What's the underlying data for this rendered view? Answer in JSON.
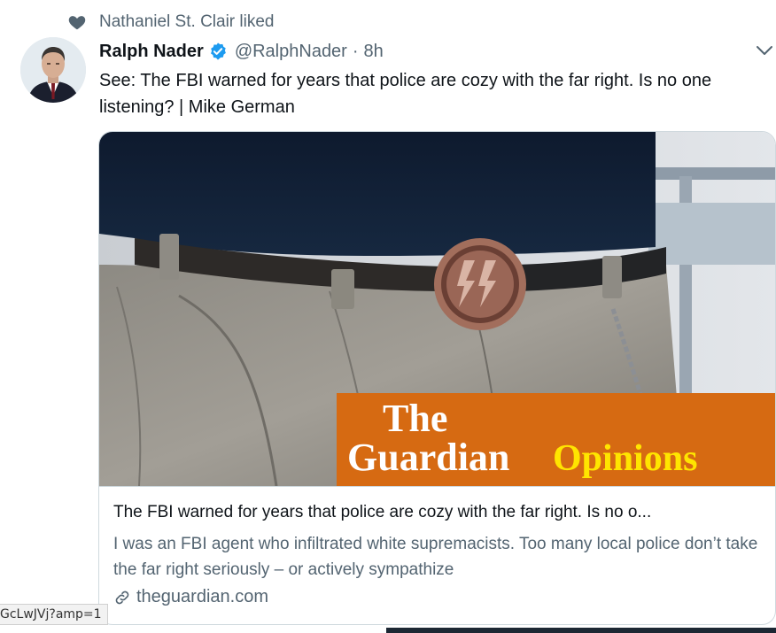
{
  "social_context": {
    "icon": "heart-icon",
    "text": "Nathaniel St. Clair liked"
  },
  "author": {
    "name": "Ralph Nader",
    "verified": true,
    "handle": "@RalphNader",
    "separator": "·",
    "time": "8h"
  },
  "tweet": {
    "text": "See: The FBI warned for years that police are cozy with the far right. Is no one listening? | Mike German"
  },
  "card": {
    "image_logo_the": "The",
    "image_logo_guardian": "Guardian",
    "image_logo_opinions": "Opinions",
    "title": "The FBI warned for years that police are cozy with the far right. Is no o...",
    "description": "I was an FBI agent who infiltrated white supremacists. Too many local police don’t take the far right seriously – or actively sympathize",
    "domain": "theguardian.com",
    "domain_icon": "link-icon"
  },
  "status_bar": {
    "url": "GcLwJVj?amp=1"
  },
  "colors": {
    "accent_verified": "#1d9bf0",
    "secondary_text": "#536471",
    "guardian_orange": "#d66a12",
    "opinions_yellow": "#ffe500"
  }
}
